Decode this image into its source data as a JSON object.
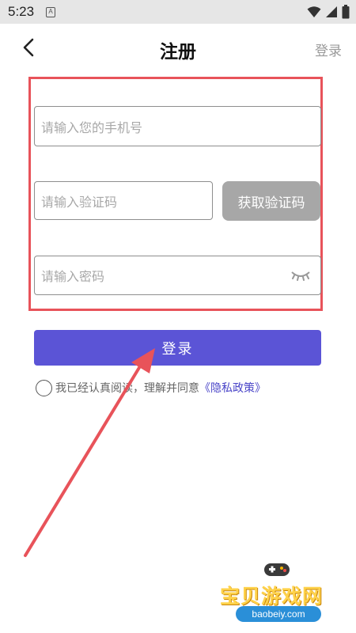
{
  "status_bar": {
    "time": "5:23",
    "notification_letter": "A"
  },
  "nav": {
    "title": "注册",
    "right_link": "登录"
  },
  "form": {
    "phone_placeholder": "请输入您的手机号",
    "code_placeholder": "请输入验证码",
    "get_code_label": "获取验证码",
    "password_placeholder": "请输入密码",
    "submit_label": "登录"
  },
  "agreement": {
    "text": "我已经认真阅读，理解并同意",
    "link": "《隐私政策》"
  },
  "watermark": {
    "name": "宝贝游戏网",
    "url": "baobeiy.com"
  },
  "colors": {
    "accent": "#5b54d6",
    "highlight": "#e8535a",
    "disabled_button": "#a7a7a7"
  }
}
